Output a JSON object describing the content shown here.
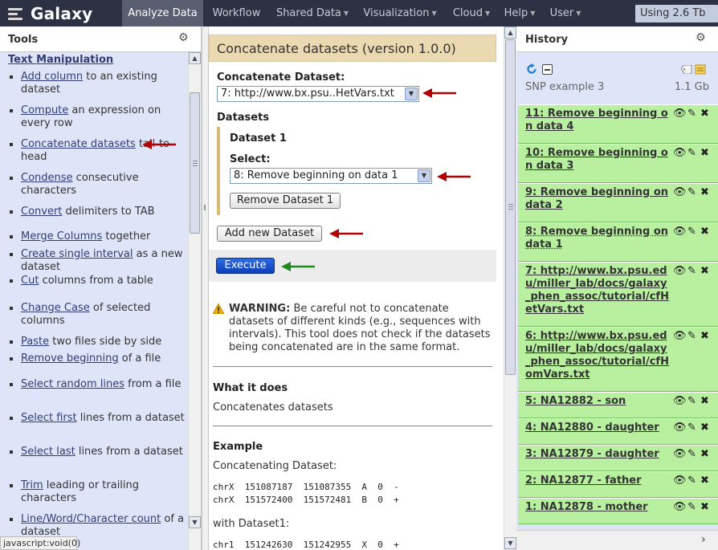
{
  "masthead": {
    "brand": "Galaxy",
    "nav": [
      {
        "label": "Analyze Data",
        "active": true,
        "caret": false
      },
      {
        "label": "Workflow",
        "active": false,
        "caret": false
      },
      {
        "label": "Shared Data",
        "active": false,
        "caret": true
      },
      {
        "label": "Visualization",
        "active": false,
        "caret": true
      },
      {
        "label": "Cloud",
        "active": false,
        "caret": true
      },
      {
        "label": "Help",
        "active": false,
        "caret": true
      },
      {
        "label": "User",
        "active": false,
        "caret": true
      }
    ],
    "quota": "Using 2.6 Tb"
  },
  "tools": {
    "title": "Tools",
    "gear_icon": "gear-icon",
    "section": "Text Manipulation",
    "items": [
      {
        "link": "Add column",
        "rest": "to an existing dataset"
      },
      {
        "link": "Compute",
        "rest": "an expression on every row"
      },
      {
        "link": "Concatenate datasets",
        "rest": "tail-to-head"
      },
      {
        "link": "Condense",
        "rest": "consecutive characters"
      },
      {
        "link": "Convert",
        "rest": "delimiters to TAB"
      },
      {
        "link": "Merge Columns",
        "rest": "together"
      },
      {
        "link": "Create single interval",
        "rest": "as a new dataset"
      },
      {
        "link": "Cut",
        "rest": "columns from a table"
      },
      {
        "link": "Change Case",
        "rest": "of selected columns"
      },
      {
        "link": "Paste",
        "rest": "two files side by side"
      },
      {
        "link": "Remove beginning",
        "rest": "of a file"
      },
      {
        "link": "Select random lines",
        "rest": "from a file"
      },
      {
        "link": "Select first",
        "rest": "lines from a dataset"
      },
      {
        "link": "Select last",
        "rest": "lines from a dataset"
      },
      {
        "link": "Trim",
        "rest": "leading or trailing characters"
      },
      {
        "link": "Line/Word/Character count",
        "rest": "of a dataset"
      }
    ]
  },
  "status_bar": "javascript:void(0)",
  "form": {
    "title": "Concatenate datasets (version 1.0.0)",
    "concat_label": "Concatenate Dataset:",
    "concat_value": "7: http://www.bx.psu..HetVars.txt",
    "datasets_label": "Datasets",
    "repeat_title": "Dataset 1",
    "select_label": "Select:",
    "select_value": "8: Remove beginning on data 1",
    "remove_button": "Remove Dataset 1",
    "add_button": "Add new Dataset",
    "execute_button": "Execute",
    "warning_bold": "WARNING:",
    "warning_text": "Be careful not to concatenate datasets of different kinds (e.g., sequences with intervals). This tool does not check if the datasets being concatenated are in the same format.",
    "what_it_does": "What it does",
    "description": "Concatenates datasets",
    "example": "Example",
    "concat_dataset_caption": "Concatenating Dataset:",
    "example_rows": [
      "chrX  151087187  151087355  A  0  -",
      "chrX  151572400  151572481  B  0  +"
    ],
    "with_caption": "with Dataset1:",
    "example_rows_2": [
      "chr1  151242630  151242955  X  0  +"
    ]
  },
  "history": {
    "title": "History",
    "name": "SNP example 3",
    "size": "1.1 Gb",
    "items": [
      {
        "title": "11: Remove beginning on data 4"
      },
      {
        "title": "10: Remove beginning on data 3"
      },
      {
        "title": "9: Remove beginning on data 2"
      },
      {
        "title": "8: Remove beginning on data 1"
      },
      {
        "title": "7: http://www.bx.psu.edu/miller_lab/docs/galaxy_phen_assoc/tutorial/cfHetVars.txt"
      },
      {
        "title": "6: http://www.bx.psu.edu/miller_lab/docs/galaxy_phen_assoc/tutorial/cfHomVars.txt"
      },
      {
        "title": "5: NA12882 - son"
      },
      {
        "title": "4: NA12880 - daughter"
      },
      {
        "title": "3: NA12879 - daughter"
      },
      {
        "title": "2: NA12877 - father"
      },
      {
        "title": "1: NA12878 - mother"
      }
    ]
  },
  "colors": {
    "masthead": "#2c3143",
    "panel": "#dfe5f9",
    "dataset_ok": "#b8f0a0",
    "annotation_red": "#b30000",
    "annotation_green": "#1e8a1e"
  }
}
